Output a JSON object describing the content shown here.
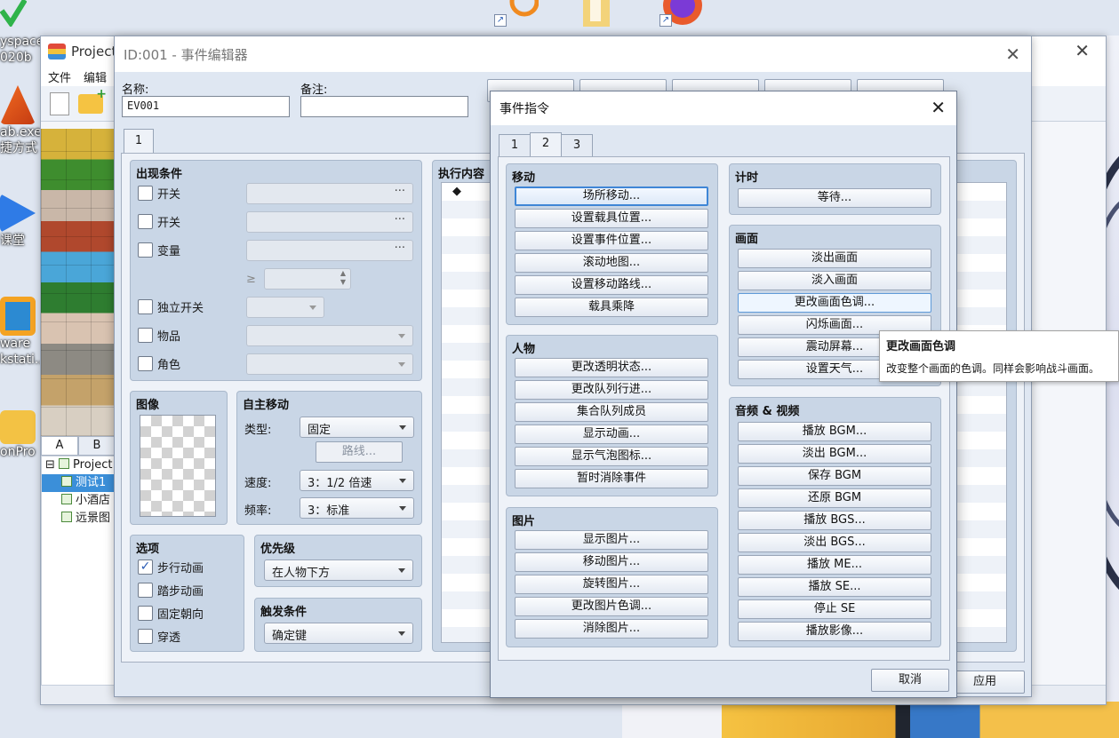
{
  "desktop": {
    "icons": [
      {
        "label": "yspace",
        "label2": "020b"
      },
      {
        "label": "ab.exe",
        "label2": "捷方式"
      },
      {
        "label": "课堂",
        "label2": ""
      },
      {
        "label": "ware",
        "label2": "kstati..."
      },
      {
        "label": "onPro",
        "label2": ""
      }
    ]
  },
  "main_window": {
    "title": "Project",
    "menu": [
      "文件",
      "编辑"
    ],
    "tile_tabs": [
      "A",
      "B"
    ],
    "map_tree": [
      "Project",
      "测试1",
      "小酒店",
      "远景图"
    ]
  },
  "event_editor": {
    "title": "ID:001 - 事件编辑器",
    "name_label": "名称:",
    "name_value": "EV001",
    "note_label": "备注:",
    "note_value": "",
    "page_tab": "1",
    "conditions": {
      "title": "出现条件",
      "switch1": "开关",
      "switch2": "开关",
      "variable": "变量",
      "gte": "≥",
      "self_switch": "独立开关",
      "item": "物品",
      "actor": "角色"
    },
    "image": {
      "title": "图像"
    },
    "autonomous": {
      "title": "自主移动",
      "type_label": "类型:",
      "type_value": "固定",
      "route_button": "路线...",
      "speed_label": "速度:",
      "speed_value": "3：1/2 倍速",
      "freq_label": "频率:",
      "freq_value": "3：标准"
    },
    "options": {
      "title": "选项",
      "walking": "步行动画",
      "stepping": "踏步动画",
      "direction_fix": "固定朝向",
      "through": "穿透"
    },
    "priority": {
      "title": "优先级",
      "value": "在人物下方"
    },
    "trigger": {
      "title": "触发条件",
      "value": "确定键"
    },
    "contents": {
      "title": "执行内容",
      "marker": "◆"
    },
    "apply_button": "应用"
  },
  "command_dialog": {
    "title": "事件指令",
    "tabs": [
      "1",
      "2",
      "3"
    ],
    "active_tab": "2",
    "groups": {
      "movement": {
        "title": "移动",
        "items": [
          "场所移动...",
          "设置载具位置...",
          "设置事件位置...",
          "滚动地图...",
          "设置移动路线...",
          "载具乘降"
        ]
      },
      "character": {
        "title": "人物",
        "items": [
          "更改透明状态...",
          "更改队列行进...",
          "集合队列成员",
          "显示动画...",
          "显示气泡图标...",
          "暂时消除事件"
        ]
      },
      "picture": {
        "title": "图片",
        "items": [
          "显示图片...",
          "移动图片...",
          "旋转图片...",
          "更改图片色调...",
          "消除图片..."
        ]
      },
      "timing": {
        "title": "计时",
        "items": [
          "等待..."
        ]
      },
      "screen": {
        "title": "画面",
        "items": [
          "淡出画面",
          "淡入画面",
          "更改画面色调...",
          "闪烁画面...",
          "震动屏幕...",
          "设置天气..."
        ]
      },
      "audio": {
        "title": "音频 & 视频",
        "items": [
          "播放 BGM...",
          "淡出 BGM...",
          "保存 BGM",
          "还原 BGM",
          "播放 BGS...",
          "淡出 BGS...",
          "播放 ME...",
          "播放 SE...",
          "停止 SE",
          "播放影像..."
        ]
      }
    },
    "cancel_button": "取消"
  },
  "tooltip": {
    "title": "更改画面色调",
    "body": "改变整个画面的色调。同样会影响战斗画面。"
  },
  "colors": {
    "panel": "#c9d6e6",
    "focus": "#3f86d6",
    "selection": "#3b8fd9"
  }
}
